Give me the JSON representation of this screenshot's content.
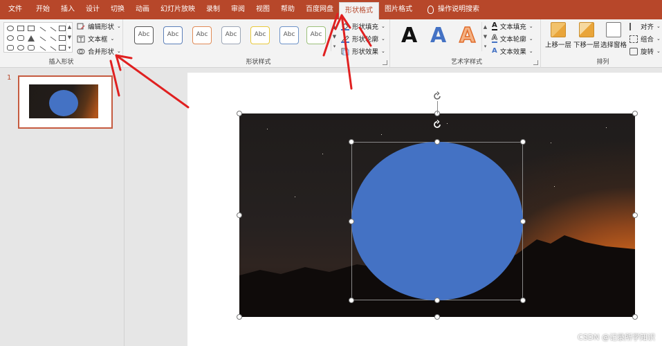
{
  "tabs": [
    {
      "label": "文件"
    },
    {
      "label": "开始"
    },
    {
      "label": "插入"
    },
    {
      "label": "设计"
    },
    {
      "label": "切换"
    },
    {
      "label": "动画"
    },
    {
      "label": "幻灯片放映"
    },
    {
      "label": "录制"
    },
    {
      "label": "审阅"
    },
    {
      "label": "视图"
    },
    {
      "label": "帮助"
    },
    {
      "label": "百度网盘"
    },
    {
      "label": "形状格式"
    },
    {
      "label": "图片格式"
    }
  ],
  "tell_me": "操作说明搜索",
  "insert_shapes": {
    "group_label": "插入形状",
    "edit_shape": "编辑形状",
    "text_box": "文本框",
    "merge_shapes": "合并形状"
  },
  "shape_styles": {
    "group_label": "形状样式",
    "preset_label": "Abc",
    "preset_colors": [
      "#555555",
      "#5b7fb8",
      "#e08a55",
      "#9aa5b5",
      "#e8c93a",
      "#6d93c7",
      "#9bc07a"
    ],
    "fill": "形状填充",
    "outline": "形状轮廓",
    "effects": "形状效果"
  },
  "wordart": {
    "group_label": "艺术字样式",
    "sample_letter": "A",
    "text_fill": "文本填充",
    "text_outline": "文本轮廓",
    "text_effects": "文本效果"
  },
  "arrange": {
    "group_label": "排列",
    "bring_forward": "上移一层",
    "send_backward": "下移一层",
    "selection_pane": "选择窗格",
    "align": "对齐",
    "group": "组合",
    "rotate": "旋转"
  },
  "thumbnails": [
    {
      "number": "1"
    }
  ],
  "colors": {
    "accent": "#b7472a",
    "shape_fill": "#4472c4",
    "annotation_arrow": "#e02020"
  },
  "watermark": "CSDN @记录所学知识"
}
